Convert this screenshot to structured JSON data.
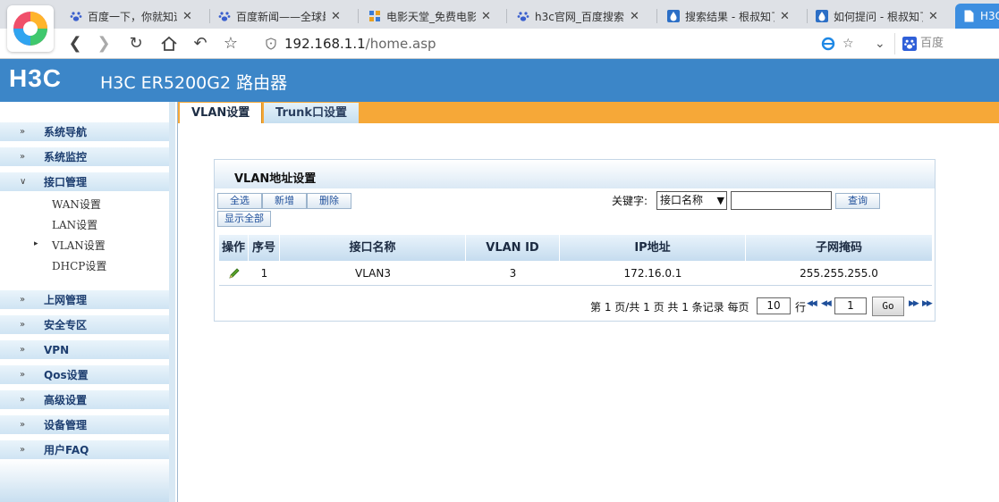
{
  "browser": {
    "tabs": [
      {
        "title": "百度一下，你就知道"
      },
      {
        "title": "百度新闻——全球最大"
      },
      {
        "title": "电影天堂_免费电影_迅"
      },
      {
        "title": "h3c官网_百度搜索"
      },
      {
        "title": "搜索结果 - 根叔知了"
      },
      {
        "title": "如何提问 - 根叔知了"
      },
      {
        "title": "H3C"
      }
    ],
    "url_host": "192.168.1.1",
    "url_path": "/home.asp",
    "search_engine": "百度"
  },
  "router": {
    "logo": "H3C",
    "title": "H3C ER5200G2 路由器"
  },
  "sidebar": {
    "items": [
      {
        "label": "系统导航"
      },
      {
        "label": "系统监控"
      },
      {
        "label": "接口管理"
      },
      {
        "label": "上网管理"
      },
      {
        "label": "安全专区"
      },
      {
        "label": "VPN"
      },
      {
        "label": "Qos设置"
      },
      {
        "label": "高级设置"
      },
      {
        "label": "设备管理"
      },
      {
        "label": "用户FAQ"
      }
    ],
    "subitems": [
      {
        "label": "WAN设置"
      },
      {
        "label": "LAN设置"
      },
      {
        "label": "VLAN设置"
      },
      {
        "label": "DHCP设置"
      }
    ]
  },
  "content": {
    "tabs": [
      {
        "label": "VLAN设置"
      },
      {
        "label": "Trunk口设置"
      }
    ],
    "panel_title": "VLAN地址设置",
    "buttons": {
      "select_all": "全选",
      "add": "新增",
      "delete": "删除",
      "show_all": "显示全部",
      "query": "查询"
    },
    "keyword_label": "关键字:",
    "keyword_option": "接口名称",
    "keyword_value": "",
    "table": {
      "headers": [
        "操作",
        "序号",
        "接口名称",
        "VLAN ID",
        "IP地址",
        "子网掩码"
      ],
      "rows": [
        {
          "seq": "1",
          "name": "VLAN3",
          "vlan_id": "3",
          "ip": "172.16.0.1",
          "mask": "255.255.255.0"
        }
      ]
    },
    "pager": {
      "summary": "第 1 页/共 1 页 共 1 条记录 每页",
      "per_page": "10",
      "rows_label": "行",
      "page": "1",
      "go": "Go"
    }
  },
  "colors": {
    "header_blue": "#3c86c8",
    "tab_orange": "#f6a838",
    "sidebar_blue": "#d8e8f4"
  }
}
